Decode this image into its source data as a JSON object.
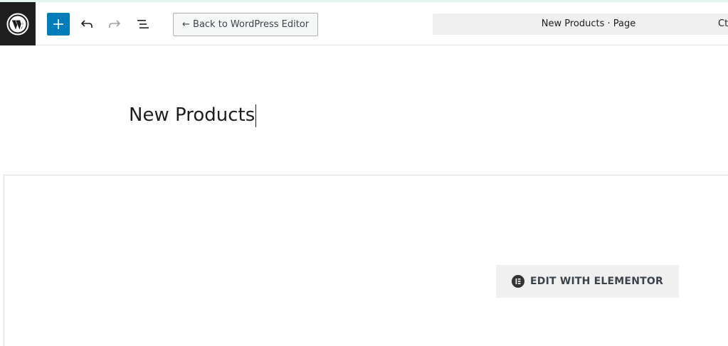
{
  "header": {
    "add_block_label": "+",
    "back_button_label": "← Back to WordPress Editor",
    "document_title": "New Products · Page",
    "command_shortcut": "Ctrl+K"
  },
  "editor": {
    "post_title": "New Products"
  },
  "elementor": {
    "button_label": "EDIT WITH ELEMENTOR"
  },
  "colors": {
    "primary": "#007cba",
    "logo_bg": "#1e1e1e",
    "elementor_icon": "#333333"
  }
}
